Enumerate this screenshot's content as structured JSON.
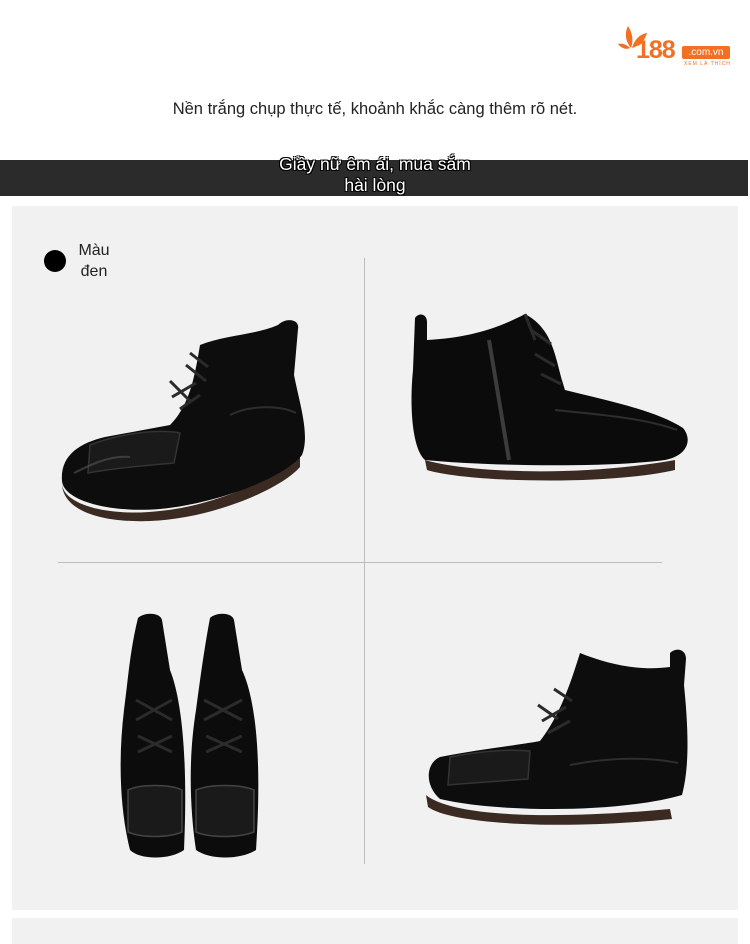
{
  "logo": {
    "number": "188",
    "domain": ".com.vn",
    "tagline": "XEM LÀ THÍCH",
    "color": "#f36f21"
  },
  "intro_text": "Nền trắng chụp thực tế, khoảnh khắc càng thêm rõ nét.",
  "banner": {
    "line1": "Giầy nữ êm ái, mua sắm",
    "line2": "hài lòng"
  },
  "color_option": {
    "label_line1": "Màu",
    "label_line2": "đen",
    "swatch_color": "#000000"
  },
  "photos": [
    "front-three-quarter-view",
    "side-view-zipper",
    "front-pair-view",
    "outer-side-view"
  ]
}
